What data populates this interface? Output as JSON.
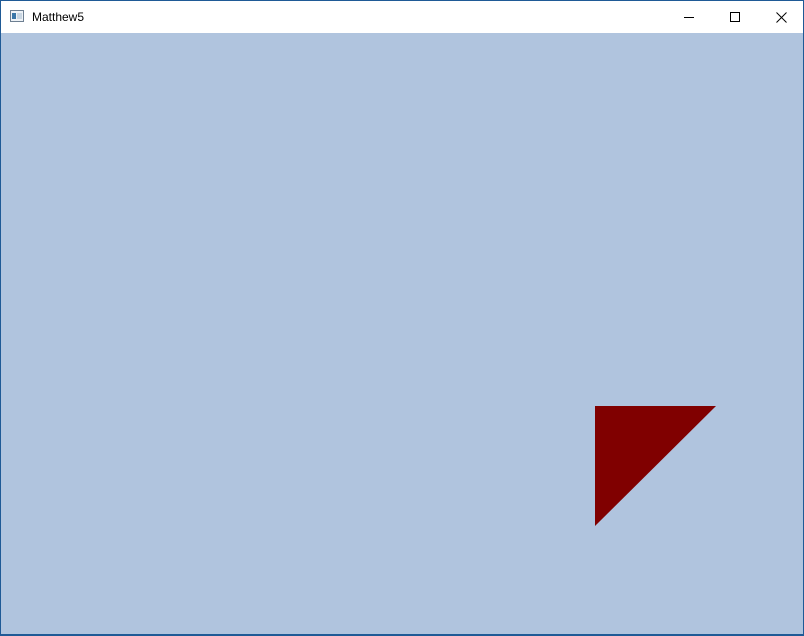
{
  "window": {
    "title": "Matthew5",
    "background_color": "#b0c4de",
    "controls": {
      "minimize_icon": "minimize-icon",
      "maximize_icon": "maximize-icon",
      "close_icon": "close-icon"
    }
  },
  "canvas": {
    "shape": "triangle",
    "fill_color": "#800000"
  }
}
